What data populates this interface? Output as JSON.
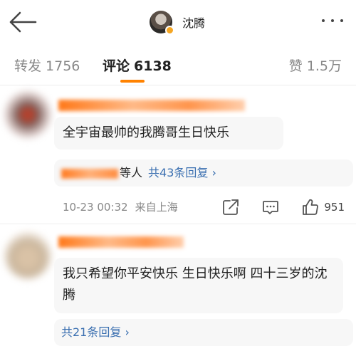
{
  "header": {
    "account_name": "沈腾"
  },
  "tabs": {
    "repost_label": "转发",
    "repost_count": "1756",
    "comment_label": "评论",
    "comment_count": "6138",
    "like_label": "赞",
    "like_count": "1.5万"
  },
  "colors": {
    "accent": "#ff8200",
    "link": "#3a6fb0"
  },
  "comments": [
    {
      "text": "全宇宙最帅的我腾哥生日快乐",
      "replies_suffix": "等人",
      "replies_link": "共43条回复 ›",
      "date": "10-23 00:32",
      "location": "来自上海",
      "likes": "951"
    },
    {
      "text": "我只希望你平安快乐 生日快乐啊 四十三岁的沈腾",
      "replies_link": "共21条回复 ›"
    }
  ]
}
